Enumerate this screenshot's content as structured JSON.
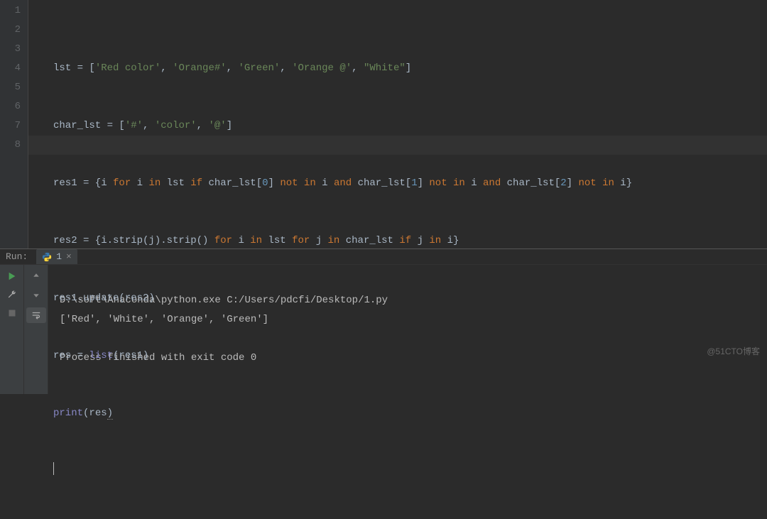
{
  "editor": {
    "lines": [
      1,
      2,
      3,
      4,
      5,
      6,
      7,
      8
    ],
    "code": {
      "l1": {
        "a": "lst = [",
        "s1": "'Red color'",
        "c1": ", ",
        "s2": "'Orange#'",
        "c2": ", ",
        "s3": "'Green'",
        "c3": ", ",
        "s4": "'Orange @'",
        "c4": ", ",
        "s5": "\"White\"",
        "b": "]"
      },
      "l2": {
        "a": "char_lst = [",
        "s1": "'#'",
        "c1": ", ",
        "s2": "'color'",
        "c2": ", ",
        "s3": "'@'",
        "b": "]"
      },
      "l3": {
        "a": "res1 = {i ",
        "k1": "for ",
        "b": "i ",
        "k2": "in ",
        "c": "lst ",
        "k3": "if ",
        "d": "char_lst[",
        "n0": "0",
        "e": "] ",
        "k4": "not in ",
        "f": "i ",
        "k5": "and ",
        "g": "char_lst[",
        "n1": "1",
        "h": "] ",
        "k6": "not in ",
        "i": "i ",
        "k7": "and ",
        "j": "char_lst[",
        "n2": "2",
        "k": "] ",
        "k8": "not in ",
        "l": "i}"
      },
      "l4": {
        "a": "res2 = {i.strip(j).strip() ",
        "k1": "for ",
        "b": "i ",
        "k2": "in ",
        "c": "lst ",
        "k3": "for ",
        "d": "j ",
        "k4": "in ",
        "e": "char_lst ",
        "k5": "if ",
        "f": "j ",
        "k6": "in ",
        "g": "i}"
      },
      "l5": {
        "a": "res1.update(res2)"
      },
      "l6": {
        "a": "res = ",
        "fn": "list",
        "b": "(res1)"
      },
      "l7": {
        "fn": "print",
        "a": "(res",
        ")": ")"
      },
      "l8": {
        "a": ""
      }
    }
  },
  "run": {
    "label": "Run:",
    "tab": {
      "name": "1",
      "close": "×"
    },
    "output": {
      "cmd": "D:\\soft\\Anaconda\\python.exe C:/Users/pdcfi/Desktop/1.py",
      "result": "['Red', 'White', 'Orange', 'Green']",
      "finished": "Process finished with exit code 0"
    }
  },
  "watermark": "@51CTO博客"
}
